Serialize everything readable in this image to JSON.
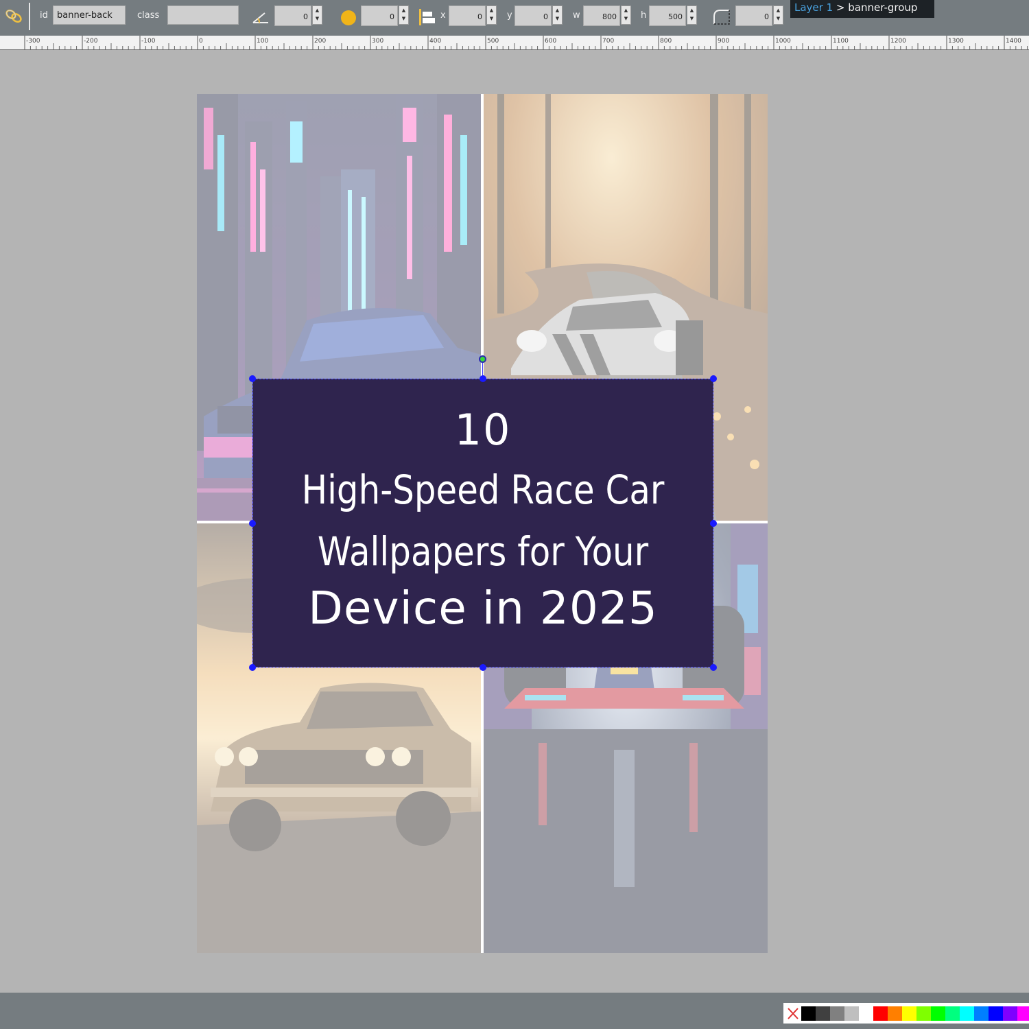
{
  "toolbar": {
    "id_label": "id",
    "id_value": "banner-back",
    "class_label": "class",
    "class_value": "",
    "angle_value": "0",
    "blur_value": "0",
    "x_label": "x",
    "x_value": "0",
    "y_label": "y",
    "y_value": "0",
    "w_label": "w",
    "w_value": "800",
    "h_label": "h",
    "h_value": "500",
    "radius_value": "0",
    "icons": [
      "link-icon",
      "angle-icon",
      "blur-icon",
      "position-icon",
      "corner-radius-icon"
    ]
  },
  "breadcrumb": {
    "layer": "Layer 1",
    "separator": ">",
    "group": "banner-group"
  },
  "ruler": {
    "ticks": [
      "-300",
      "-200",
      "-100",
      "0",
      "100",
      "200",
      "300",
      "400",
      "500",
      "600",
      "700",
      "800",
      "900",
      "1000",
      "1100",
      "1200",
      "1300",
      "1400"
    ]
  },
  "banner": {
    "number": "10",
    "line1": "High-Speed Race Car",
    "line2": "Wallpapers for Your",
    "line3": "Device in 2025",
    "background": "#2f244e"
  },
  "canvas": {
    "tiles": [
      "neon-city-car-image",
      "autumn-road-sports-car-image",
      "sunset-muscle-car-image",
      "formula-one-car-image"
    ]
  },
  "palette": {
    "colors": [
      "#000000",
      "#404040",
      "#808080",
      "#bfbfbf",
      "#ffffff",
      "#ff0000",
      "#ff7f00",
      "#ffff00",
      "#7fff00",
      "#00ff00",
      "#00ff7f",
      "#00ffff",
      "#007fff",
      "#0000ff",
      "#7f00ff",
      "#ff00ff"
    ]
  }
}
